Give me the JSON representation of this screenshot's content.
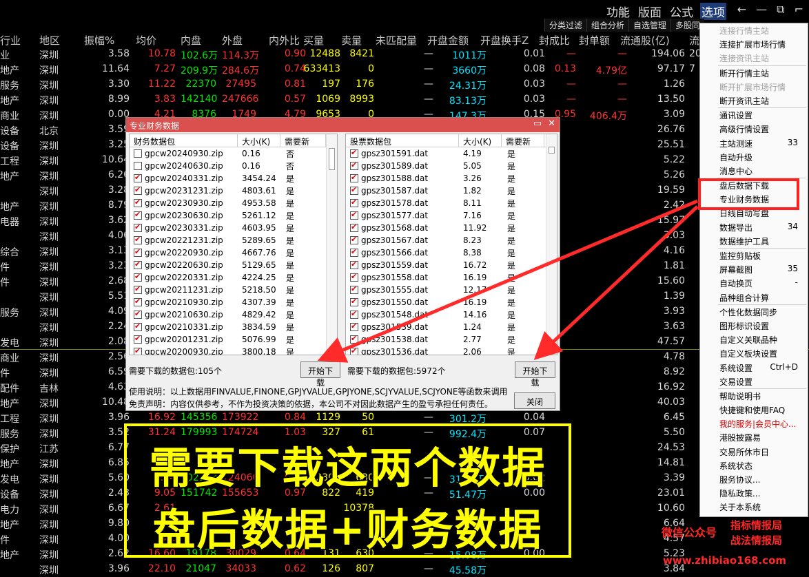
{
  "menu": [
    "功能",
    "版面",
    "公式",
    "选项"
  ],
  "winctl": [
    "←",
    "—",
    "⧉",
    "⌐"
  ],
  "subbar": [
    "分类过滤",
    "组合分析",
    "自选管理",
    "多股同"
  ],
  "columns": [
    "行业",
    "地区",
    "振幅%",
    "均价",
    "内盘",
    "外盘",
    "内外比",
    "买量",
    "卖量",
    "未匹配量",
    "开盘金额",
    "开盘换手Z",
    "封成比",
    "封单额",
    "流通股(亿)",
    "流"
  ],
  "rows": [
    [
      "业",
      "深圳",
      "3.58",
      "10.78",
      "102.6万",
      "114.3万",
      "0.90",
      "12488",
      "8421",
      "—",
      "1011万",
      "0.01",
      "—",
      "—",
      "194.06",
      "20"
    ],
    [
      "地产",
      "深圳",
      "11.64",
      "7.27",
      "209.9万",
      "284.6万",
      "0.74",
      "633413",
      "0",
      "—",
      "3660万",
      "0.08",
      "0.13",
      "4.79亿",
      "97.17",
      "7"
    ],
    [
      "服务",
      "深圳",
      "3.30",
      "11.22",
      "22370",
      "27495",
      "0.81",
      "197",
      "176",
      "—",
      "24.31万",
      "0.03",
      "—",
      "—",
      "1.26",
      ""
    ],
    [
      "地产",
      "深圳",
      "8.99",
      "3.83",
      "142140",
      "247666",
      "0.57",
      "1069",
      "8993",
      "—",
      "83.13万",
      "0.03",
      "—",
      "—",
      "13.50",
      ""
    ],
    [
      "商业",
      "深圳",
      "0.00",
      "4.21",
      "8376",
      "1749",
      "4.79",
      "9653",
      "0",
      "—",
      "147.3万",
      "0.15",
      "0.95",
      "406.4万",
      "3.09",
      ""
    ],
    [
      "设备",
      "北京",
      "3.59",
      "",
      "",
      "",
      "",
      "",
      "",
      "",
      "",
      "",
      "",
      "",
      "26.76",
      ""
    ],
    [
      "设备",
      "深圳",
      "3.25",
      "",
      "",
      "",
      "",
      "",
      "",
      "",
      "",
      "",
      "",
      "",
      "25.51",
      ""
    ],
    [
      "工程",
      "深圳",
      "10.64",
      "",
      "",
      "",
      "",
      "",
      "",
      "",
      "",
      "",
      "",
      "",
      "5.22",
      ""
    ],
    [
      "地产",
      "深圳",
      "6.26",
      "",
      "",
      "",
      "",
      "",
      "",
      "",
      "",
      "",
      "",
      "",
      "5.26",
      ""
    ],
    [
      "",
      "深圳",
      "3.28",
      "",
      "",
      "",
      "",
      "",
      "",
      "",
      "",
      "",
      "",
      "",
      "19.59",
      ""
    ],
    [
      "地产",
      "深圳",
      "8.79",
      "",
      "",
      "",
      "",
      "",
      "",
      "",
      "",
      "",
      "",
      "",
      "2.42",
      ""
    ],
    [
      "电器",
      "深圳",
      "3.62",
      "",
      "",
      "",
      "",
      "",
      "",
      "",
      "",
      "",
      "",
      "",
      "15.97",
      ""
    ],
    [
      "",
      "深圳",
      "4.06",
      "",
      "",
      "",
      "",
      "",
      "",
      "",
      "",
      "",
      "",
      "",
      "3.03",
      ""
    ],
    [
      "综合",
      "深圳",
      "3.13",
      "",
      "",
      "",
      "",
      "",
      "",
      "",
      "",
      "",
      "",
      "",
      "4.16",
      ""
    ],
    [
      "件",
      "深圳",
      "3.23",
      "",
      "",
      "",
      "",
      "",
      "",
      "",
      "",
      "",
      "",
      "",
      "1.81",
      ""
    ],
    [
      "件",
      "深圳",
      "2.68",
      "",
      "",
      "",
      "",
      "",
      "",
      "",
      "",
      "",
      "",
      "",
      "15.60",
      ""
    ],
    [
      "",
      "深圳",
      "5.51",
      "",
      "",
      "",
      "",
      "",
      "",
      "",
      "",
      "",
      "",
      "",
      "1.39",
      ""
    ],
    [
      "服务",
      "深圳",
      "4.09",
      "",
      "",
      "",
      "",
      "",
      "",
      "",
      "",
      "",
      "",
      "",
      "3.93",
      ""
    ],
    [
      "",
      "深圳",
      "2.24",
      "",
      "",
      "",
      "",
      "",
      "",
      "",
      "",
      "",
      "",
      "",
      "3.63",
      ""
    ],
    [
      "发电",
      "深圳",
      "2.08",
      "",
      "",
      "",
      "",
      "",
      "",
      "",
      "",
      "",
      "",
      "",
      "47.57",
      ""
    ],
    [
      "商业",
      "深圳",
      "2.56",
      "",
      "",
      "",
      "",
      "",
      "",
      "",
      "",
      "",
      "",
      "",
      "4.78",
      ""
    ],
    [
      "件",
      "深圳",
      "6.59",
      "",
      "",
      "",
      "",
      "",
      "",
      "",
      "",
      "",
      "",
      "",
      "8.92",
      ""
    ],
    [
      "配件",
      "吉林",
      "4.63",
      "",
      "",
      "",
      "",
      "",
      "",
      "",
      "",
      "",
      "",
      "",
      "16.92",
      ""
    ],
    [
      "地产",
      "深圳",
      "10.48",
      "",
      "",
      "",
      "",
      "",
      "",
      "",
      "",
      "",
      "",
      "",
      "40.03",
      ""
    ],
    [
      "工程",
      "深圳",
      "3.96",
      "16.92",
      "145356",
      "173922",
      "0.84",
      "1129",
      "50",
      "—",
      "301.2万",
      "0.04",
      "",
      "",
      "6.45",
      ""
    ],
    [
      "服务",
      "深圳",
      "3.52",
      "31.24",
      "179993",
      "174724",
      "1.03",
      "327",
      "61",
      "—",
      "992.4万",
      "0.07",
      "",
      "",
      "5.50",
      ""
    ],
    [
      "保护",
      "江苏",
      "6.77",
      "",
      "",
      "",
      "",
      "",
      "",
      "",
      "",
      "",
      "",
      "",
      "24.53",
      ""
    ],
    [
      "地产",
      "深圳",
      "6.85",
      "",
      "",
      "",
      "",
      "",
      "",
      "",
      "",
      "",
      "",
      "",
      "14.81",
      ""
    ],
    [
      "发电",
      "深圳",
      "5.60",
      "8.04",
      "102123",
      "124060",
      "0.82",
      "2309",
      "630",
      "—",
      "31.83万",
      "0.02",
      "",
      "",
      "3.39",
      ""
    ],
    [
      "设备",
      "深圳",
      "2.43",
      "9.05",
      "151742",
      "155653",
      "0.97",
      "822",
      "419",
      "—",
      "51.47万",
      "0.00",
      "",
      "",
      "23.01",
      ""
    ],
    [
      "电力",
      "深圳",
      "6.67",
      "2.61",
      "",
      "",
      "",
      "",
      "10378",
      "",
      "",
      "",
      "",
      "",
      "10.60",
      ""
    ],
    [
      "地产",
      "深圳",
      "9.80",
      "4.25",
      "",
      "",
      "",
      "",
      "",
      "",
      "",
      "",
      "",
      "",
      "6.64",
      ""
    ],
    [
      "件",
      "深圳",
      "4.00",
      "9.2",
      "",
      "",
      "",
      "",
      "",
      "",
      "",
      "",
      "",
      "",
      "4.57",
      ""
    ],
    [
      "地产",
      "深圳",
      "2.62",
      "16.60",
      "19178",
      "30029",
      "0.64",
      "131",
      "630",
      "—",
      "15.08万",
      "0.00",
      "",
      "",
      "5.23",
      ""
    ],
    [
      "",
      "深圳",
      "3.96",
      "22.10",
      "21047",
      "34033",
      "0.62",
      "126",
      "807",
      "—",
      "45.58万",
      "",
      "",
      "",
      "3.84",
      ""
    ]
  ],
  "dialog": {
    "title": "专业财务数据",
    "left_headers": [
      "财务数据包",
      "大小(K)",
      "需要新"
    ],
    "left_rows": [
      {
        "checked": false,
        "name": "gpcw20240930.zip",
        "size": "0.16",
        "need": "否"
      },
      {
        "checked": false,
        "name": "gpcw20240630.zip",
        "size": "0.16",
        "need": "否"
      },
      {
        "checked": true,
        "name": "gpcw20240331.zip",
        "size": "3454.24",
        "need": "是"
      },
      {
        "checked": true,
        "name": "gpcw20231231.zip",
        "size": "4803.61",
        "need": "是"
      },
      {
        "checked": true,
        "name": "gpcw20230930.zip",
        "size": "4953.58",
        "need": "是"
      },
      {
        "checked": true,
        "name": "gpcw20230630.zip",
        "size": "5261.12",
        "need": "是"
      },
      {
        "checked": true,
        "name": "gpcw20230331.zip",
        "size": "4603.95",
        "need": "是"
      },
      {
        "checked": true,
        "name": "gpcw20221231.zip",
        "size": "5289.65",
        "need": "是"
      },
      {
        "checked": true,
        "name": "gpcw20220930.zip",
        "size": "4667.76",
        "need": "是"
      },
      {
        "checked": true,
        "name": "gpcw20220630.zip",
        "size": "5129.65",
        "need": "是"
      },
      {
        "checked": true,
        "name": "gpcw20220331.zip",
        "size": "4224.25",
        "need": "是"
      },
      {
        "checked": true,
        "name": "gpcw20211231.zip",
        "size": "5218.50",
        "need": "是"
      },
      {
        "checked": true,
        "name": "gpcw20210930.zip",
        "size": "4307.39",
        "need": "是"
      },
      {
        "checked": true,
        "name": "gpcw20210630.zip",
        "size": "4829.42",
        "need": "是"
      },
      {
        "checked": true,
        "name": "gpcw20210331.zip",
        "size": "3834.59",
        "need": "是"
      },
      {
        "checked": true,
        "name": "gpcw20201231.zip",
        "size": "5076.99",
        "need": "是"
      },
      {
        "checked": true,
        "name": "gpcw20200930.zip",
        "size": "3800.18",
        "need": "是"
      }
    ],
    "right_headers": [
      "股票数据包",
      "大小(K)",
      "需要新"
    ],
    "right_rows": [
      {
        "checked": true,
        "name": "gpsz301591.dat",
        "size": "4.19",
        "need": "是"
      },
      {
        "checked": true,
        "name": "gpsz301589.dat",
        "size": "5.05",
        "need": "是"
      },
      {
        "checked": true,
        "name": "gpsz301588.dat",
        "size": "3.26",
        "need": "是"
      },
      {
        "checked": true,
        "name": "gpsz301587.dat",
        "size": "1.82",
        "need": "是"
      },
      {
        "checked": true,
        "name": "gpsz301578.dat",
        "size": "8.11",
        "need": "是"
      },
      {
        "checked": true,
        "name": "gpsz301577.dat",
        "size": "7.16",
        "need": "是"
      },
      {
        "checked": true,
        "name": "gpsz301568.dat",
        "size": "11.92",
        "need": "是"
      },
      {
        "checked": true,
        "name": "gpsz301567.dat",
        "size": "8.23",
        "need": "是"
      },
      {
        "checked": true,
        "name": "gpsz301566.dat",
        "size": "8.38",
        "need": "是"
      },
      {
        "checked": true,
        "name": "gpsz301559.dat",
        "size": "16.72",
        "need": "是"
      },
      {
        "checked": true,
        "name": "gpsz301558.dat",
        "size": "16.19",
        "need": "是"
      },
      {
        "checked": true,
        "name": "gpsz301555.dat",
        "size": "12.17",
        "need": "是"
      },
      {
        "checked": true,
        "name": "gpsz301550.dat",
        "size": "16.19",
        "need": "是"
      },
      {
        "checked": true,
        "name": "gpsz301548.dat",
        "size": "14.16",
        "need": "是"
      },
      {
        "checked": true,
        "name": "gpsz301539.dat",
        "size": "1.24",
        "need": "是"
      },
      {
        "checked": true,
        "name": "gpsz301538.dat",
        "size": "2.77",
        "need": "是"
      },
      {
        "checked": true,
        "name": "gpsz301536.dat",
        "size": "2.06",
        "need": "是"
      }
    ],
    "left_count": "需要下载的数据包:105个",
    "right_count": "需要下载的数据包:5972个",
    "start_btn": "开始下载",
    "usage": "使用说明：以上数据用FINVALUE,FINONE,GPJYVALUE,GPJYONE,SCJYVALUE,SCJYONE等函数来调用",
    "disclaimer": "免责声明：内容仅供参考，不作为投资决策的依据，本公司不对因此数据产生的盈亏承担任何责任。",
    "close_btn": "关闭"
  },
  "right_menu": [
    {
      "label": "连接行情主站",
      "state": "dis"
    },
    {
      "label": "连接扩展市场行情",
      "state": ""
    },
    {
      "label": "连接资讯主站",
      "state": "dis"
    },
    {
      "sep": true
    },
    {
      "label": "断开行情主站",
      "state": ""
    },
    {
      "label": "断开扩展市场行情",
      "state": "dis"
    },
    {
      "label": "断开资讯主站",
      "state": ""
    },
    {
      "sep": true
    },
    {
      "label": "通讯设置",
      "state": ""
    },
    {
      "label": "高级行情设置",
      "state": ""
    },
    {
      "label": "主站测速",
      "state": "",
      "shortcut": "33"
    },
    {
      "label": "自动升级",
      "state": ""
    },
    {
      "label": "消息中心",
      "state": ""
    },
    {
      "sep": true
    },
    {
      "label": "盘后数据下载",
      "state": ""
    },
    {
      "label": "专业财务数据",
      "state": ""
    },
    {
      "label": "日线自动写盘",
      "state": ""
    },
    {
      "label": "数据导出",
      "state": "",
      "shortcut": "34"
    },
    {
      "label": "数据维护工具",
      "state": ""
    },
    {
      "sep": true
    },
    {
      "label": "监控剪贴板",
      "state": ""
    },
    {
      "label": "屏幕截图",
      "state": "",
      "shortcut": "35"
    },
    {
      "label": "自动换页",
      "state": "",
      "shortcut": "-"
    },
    {
      "label": "品种组合计算",
      "state": ""
    },
    {
      "sep": true
    },
    {
      "label": "个性化数据同步",
      "state": ""
    },
    {
      "label": "图形标识设置",
      "state": ""
    },
    {
      "label": "自定义关联品种",
      "state": ""
    },
    {
      "label": "自定义板块设置",
      "state": ""
    },
    {
      "label": "系统设置",
      "state": "",
      "shortcut": "Ctrl+D"
    },
    {
      "label": "交易设置",
      "state": ""
    },
    {
      "sep": true
    },
    {
      "label": "帮助说明书",
      "state": ""
    },
    {
      "label": "快捷键和使用FAQ",
      "state": ""
    },
    {
      "label": "我的服务|会员中心...",
      "state": "link"
    },
    {
      "label": "港股披露易",
      "state": ""
    },
    {
      "label": "交易所休市日",
      "state": ""
    },
    {
      "label": "系统状态",
      "state": ""
    },
    {
      "label": "服务协议...",
      "state": ""
    },
    {
      "label": "隐私政策...",
      "state": ""
    },
    {
      "label": "关于本系统",
      "state": ""
    }
  ],
  "banner": {
    "line1": "需要下载这两个数据",
    "line2": "盘后数据+财务数据"
  },
  "watermark": {
    "wechat": "微信公众号",
    "name1": "指标情报局",
    "name2": "战法情报局",
    "url": "www.zhibiao168.com"
  },
  "colors": {
    "dialog_title": "#d9504f",
    "highlight": "#ff2020",
    "banner": "#ffff00"
  }
}
